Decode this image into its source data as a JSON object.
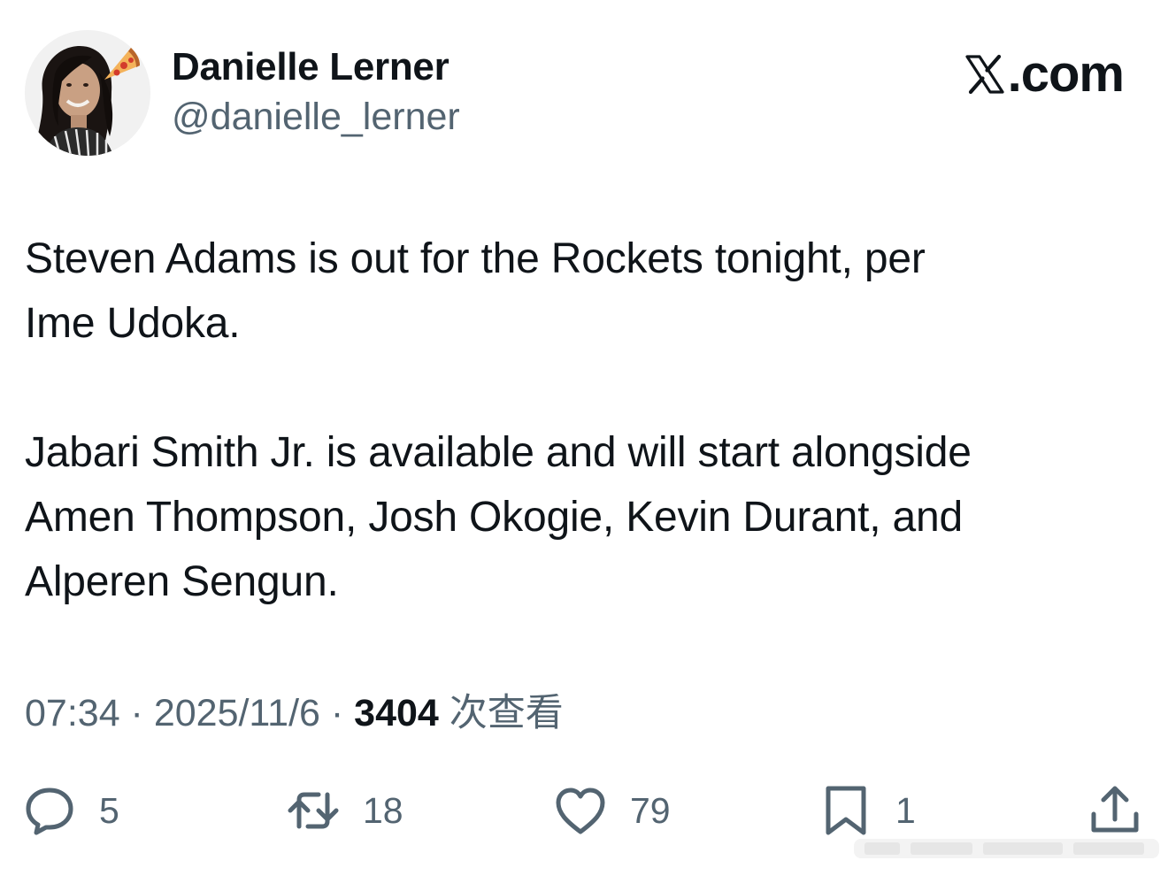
{
  "author": {
    "display_name": "Danielle Lerner",
    "handle": "@danielle_lerner"
  },
  "brand": {
    "logo_icon": "x-logo-icon",
    "site_label": ".com"
  },
  "tweet": {
    "text": "Steven Adams is out for the Rockets tonight, per\nIme Udoka.\n\nJabari Smith Jr. is available and will start alongside\nAmen Thompson, Josh Okogie, Kevin Durant, and\nAlperen Sengun."
  },
  "meta": {
    "time": "07:34",
    "separator": " · ",
    "date": "2025/11/6",
    "views_count": "3404",
    "views_label": "次查看"
  },
  "actions": {
    "replies": {
      "icon": "reply-icon",
      "count": "5"
    },
    "retweets": {
      "icon": "retweet-icon",
      "count": "18"
    },
    "likes": {
      "icon": "heart-icon",
      "count": "79"
    },
    "bookmarks": {
      "icon": "bookmark-icon",
      "count": "1"
    },
    "share": {
      "icon": "share-icon"
    }
  },
  "colors": {
    "text_primary": "#0f1419",
    "text_secondary": "#536471",
    "background": "#ffffff"
  }
}
